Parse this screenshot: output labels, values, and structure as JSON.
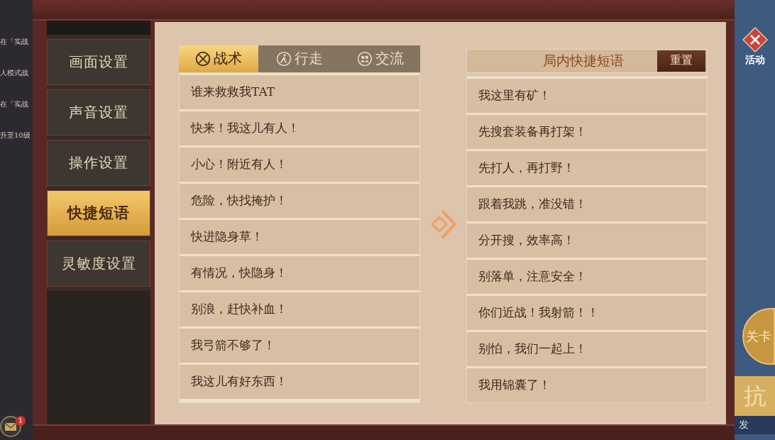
{
  "background_left": {
    "quests": [
      {
        "text": "在「实战"
      },
      {
        "text": "人模式战"
      },
      {
        "text": "在「实战"
      },
      {
        "text": "升至10级"
      }
    ],
    "mail_badge": "1"
  },
  "background_right": {
    "event_label": "活动",
    "stage_button": "关卡",
    "banner_text": "抗",
    "start_text": "发"
  },
  "sidebar": {
    "items": [
      {
        "label": "画面设置",
        "selected": false
      },
      {
        "label": "声音设置",
        "selected": false
      },
      {
        "label": "操作设置",
        "selected": false
      },
      {
        "label": "快捷短语",
        "selected": true
      },
      {
        "label": "灵敏度设置",
        "selected": false
      }
    ]
  },
  "phrase_tabs": [
    {
      "label": "战术",
      "kind": "tactics",
      "selected": true
    },
    {
      "label": "行走",
      "kind": "walk",
      "selected": false
    },
    {
      "label": "交流",
      "kind": "chat",
      "selected": false
    }
  ],
  "phrase_list": [
    "谁来救救我TAT",
    "快来！我这儿有人！",
    "小心！附近有人！",
    "危险，快找掩护！",
    "快进隐身草！",
    "有情况，快隐身！",
    "别浪，赶快补血！",
    "我弓箭不够了！",
    "我这儿有好东西！"
  ],
  "quick_phrases": {
    "title": "局内快捷短语",
    "reset_button": "重置",
    "items": [
      "我这里有矿！",
      "先搜套装备再打架！",
      "先打人，再打野！",
      "跟着我跳，准没错！",
      "分开搜，效率高！",
      "别落单，注意安全！",
      "你们近战！我射箭！！",
      "别怕，我们一起上！",
      "我用锦囊了！"
    ]
  }
}
